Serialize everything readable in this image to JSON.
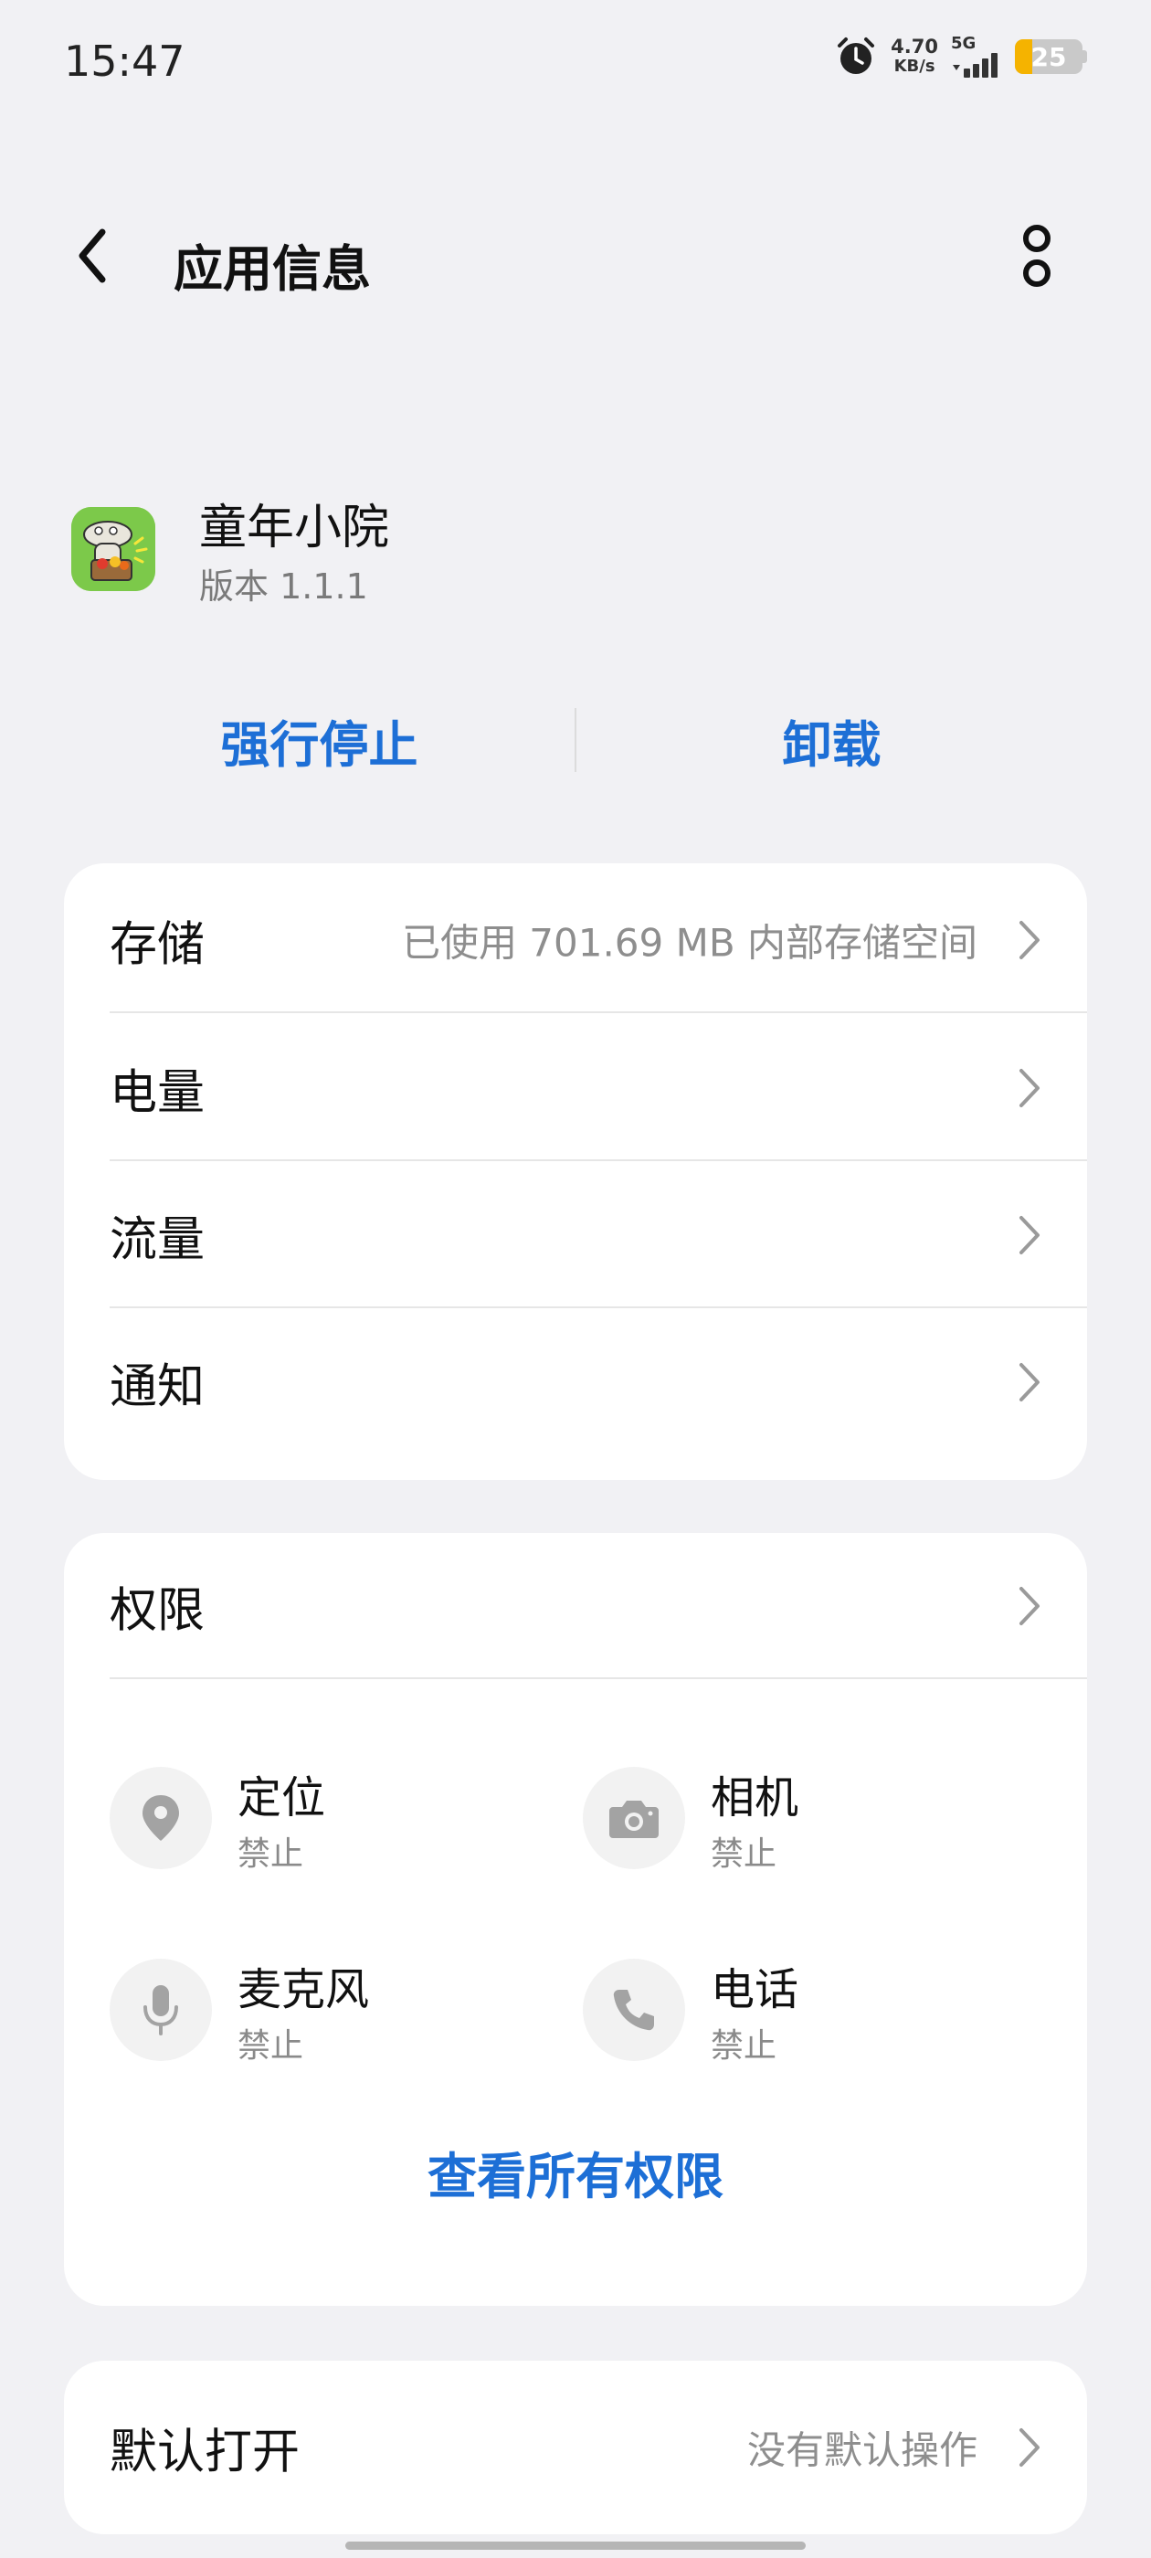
{
  "status_bar": {
    "time": "15:47",
    "net_speed_value": "4.70",
    "net_speed_unit": "KB/s",
    "network_type": "5G",
    "battery_level": "25",
    "battery_fraction": 0.25,
    "battery_color": "#f5b300",
    "icons": [
      "alarm-icon",
      "signal-icon",
      "battery-icon"
    ]
  },
  "app_bar": {
    "title": "应用信息",
    "back_icon": "chevron-left-icon",
    "more_icon": "more-vertical-icon"
  },
  "app": {
    "name": "童年小院",
    "version": "版本 1.1.1",
    "icon": "app-icon"
  },
  "actions": {
    "force_stop": "强行停止",
    "uninstall": "卸载",
    "accent_color": "#1d6fd6"
  },
  "info_rows": [
    {
      "label": "存储",
      "value": "已使用 701.69 MB 内部存储空间"
    },
    {
      "label": "电量",
      "value": ""
    },
    {
      "label": "流量",
      "value": ""
    },
    {
      "label": "通知",
      "value": ""
    }
  ],
  "permissions": {
    "title": "权限",
    "items": [
      {
        "name": "定位",
        "status": "禁止",
        "icon": "location-icon"
      },
      {
        "name": "相机",
        "status": "禁止",
        "icon": "camera-icon"
      },
      {
        "name": "麦克风",
        "status": "禁止",
        "icon": "microphone-icon"
      },
      {
        "name": "电话",
        "status": "禁止",
        "icon": "phone-icon"
      }
    ],
    "view_all": "查看所有权限"
  },
  "default_open": {
    "label": "默认打开",
    "value": "没有默认操作"
  }
}
